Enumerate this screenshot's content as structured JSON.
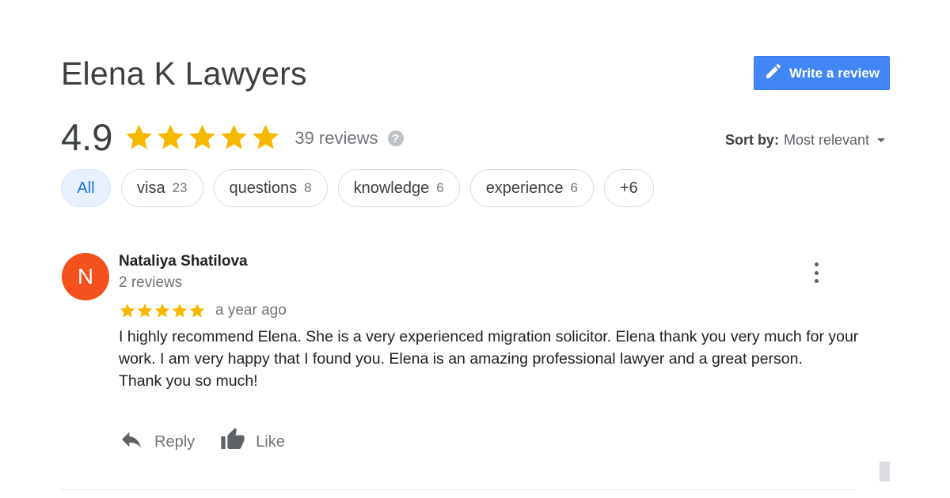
{
  "business": {
    "name": "Elena K Lawyers",
    "rating": "4.9",
    "rating_value": 4.9,
    "stars_filled": 5,
    "review_count": "39 reviews",
    "help_icon": "?"
  },
  "write_review": {
    "label": "Write a review",
    "icon": "pencil-icon"
  },
  "sort": {
    "label": "Sort by:",
    "value": "Most relevant"
  },
  "topics": [
    {
      "label": "All",
      "count": ""
    },
    {
      "label": "visa",
      "count": "23"
    },
    {
      "label": "questions",
      "count": "8"
    },
    {
      "label": "knowledge",
      "count": "6"
    },
    {
      "label": "experience",
      "count": "6"
    },
    {
      "label": "+6",
      "count": ""
    }
  ],
  "review": {
    "avatar_letter": "N",
    "author": "Nataliya Shatilova",
    "author_reviews": "2 reviews",
    "stars": 5,
    "date": "a year ago",
    "body_lines": [
      "I highly recommend Elena. She is a very experienced migration solicitor.  Elena thank you very much for your work. I am very happy that I found you. Elena is an amazing professional lawyer and a great person.",
      "Thank you so much!"
    ],
    "reply_label": "Reply",
    "like_label": "Like"
  },
  "colors": {
    "star": "#f6b800",
    "button": "#4285f4",
    "avatar": "#f4511e",
    "active_chip": "#e8f0fe"
  }
}
